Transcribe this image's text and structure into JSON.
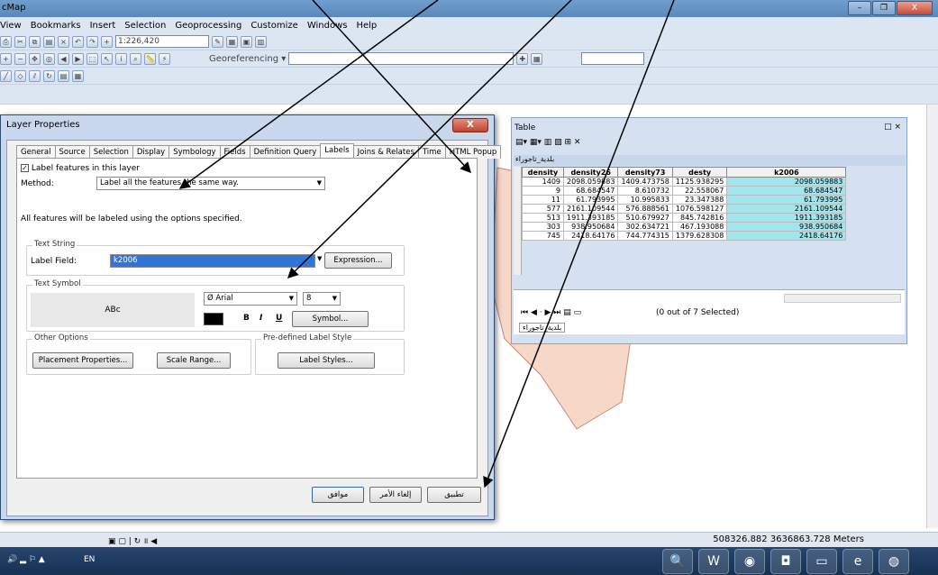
{
  "app": {
    "title": "cMap",
    "window_buttons": [
      "–",
      "❐",
      "X"
    ]
  },
  "menu": [
    "View",
    "Bookmarks",
    "Insert",
    "Selection",
    "Geoprocessing",
    "Customize",
    "Windows",
    "Help"
  ],
  "toolbar": {
    "scale": "1:226,420",
    "georef_label": "Georeferencing ▾"
  },
  "dialog": {
    "title": "Layer Properties",
    "close": "X",
    "tabs": [
      "General",
      "Source",
      "Selection",
      "Display",
      "Symbology",
      "Fields",
      "Definition Query",
      "Labels",
      "Joins & Relates",
      "Time",
      "HTML Popup"
    ],
    "active_tab": "Labels",
    "label_features": "Label features in this layer",
    "method_label": "Method:",
    "method_value": "Label all the features the same way.",
    "info": "All features will be labeled using the options specified.",
    "text_string": {
      "group": "Text String",
      "field_label": "Label Field:",
      "field_value": "k2006",
      "expression_btn": "Expression..."
    },
    "text_symbol": {
      "group": "Text Symbol",
      "preview": "ABc",
      "font": "Arial",
      "size": "8",
      "bold": "B",
      "italic": "I",
      "underline": "U",
      "symbol_btn": "Symbol..."
    },
    "other_options": {
      "group": "Other Options",
      "placement_btn": "Placement Properties...",
      "scale_btn": "Scale Range..."
    },
    "predefined": {
      "group": "Pre-defined Label Style",
      "styles_btn": "Label Styles..."
    },
    "ok": "موافق",
    "cancel": "إلغاء الأمر",
    "apply": "تطبيق"
  },
  "table_window": {
    "title": "Table",
    "layer_name": "بلدية_تاجوراء",
    "tab_name": "بلدية_تاجوراء",
    "columns": [
      "density",
      "density26",
      "density73",
      "desty",
      "k2006"
    ],
    "rows": [
      [
        "1409",
        "2098.059883",
        "1409.473758",
        "1125.938295",
        "2098.059883"
      ],
      [
        "9",
        "68.684547",
        "8.610732",
        "22.558067",
        "68.684547"
      ],
      [
        "11",
        "61.793995",
        "10.995833",
        "23.347388",
        "61.793995"
      ],
      [
        "577",
        "2161.109544",
        "576.888561",
        "1076.598127",
        "2161.109544"
      ],
      [
        "513",
        "1911.393185",
        "510.679927",
        "845.742816",
        "1911.393185"
      ],
      [
        "303",
        "938.950684",
        "302.634721",
        "467.193088",
        "938.950684"
      ],
      [
        "745",
        "2418.64176",
        "744.774315",
        "1379.628308",
        "2418.64176"
      ]
    ],
    "selection_status": "(0 out of 7 Selected)"
  },
  "status": {
    "coords": "508326.882 3636863.728 Meters"
  },
  "taskbar": {
    "lang": "EN"
  }
}
